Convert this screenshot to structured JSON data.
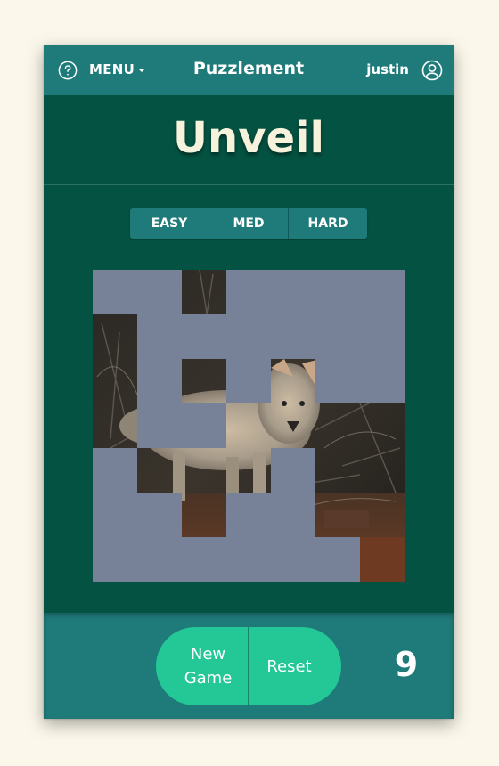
{
  "topbar": {
    "menu_label": "MENU",
    "brand": "Puzzlement",
    "username": "justin",
    "icons": [
      "help-circle-icon",
      "caret-down-icon",
      "user-circle-icon"
    ]
  },
  "game": {
    "title": "Unveil",
    "difficulty": [
      "EASY",
      "MED",
      "HARD"
    ],
    "grid": {
      "rows": 7,
      "cols": 7
    },
    "revealed_tiles": [
      [
        0,
        2
      ],
      [
        1,
        0
      ],
      [
        2,
        0
      ],
      [
        2,
        2
      ],
      [
        2,
        4
      ],
      [
        3,
        0
      ],
      [
        3,
        3
      ],
      [
        3,
        4
      ],
      [
        3,
        5
      ],
      [
        3,
        6
      ],
      [
        4,
        1
      ],
      [
        4,
        2
      ],
      [
        4,
        3
      ],
      [
        4,
        5
      ],
      [
        4,
        6
      ],
      [
        5,
        2
      ],
      [
        5,
        5
      ],
      [
        5,
        6
      ],
      [
        6,
        6
      ]
    ],
    "new_game_label_line1": "New",
    "new_game_label_line2": "Game",
    "reset_label": "Reset",
    "moves": "9"
  },
  "colors": {
    "background": "#fbf7ea",
    "card": "#045342",
    "bar": "#1f7b7a",
    "button": "#24c896",
    "hidden_tile": "#778198"
  }
}
